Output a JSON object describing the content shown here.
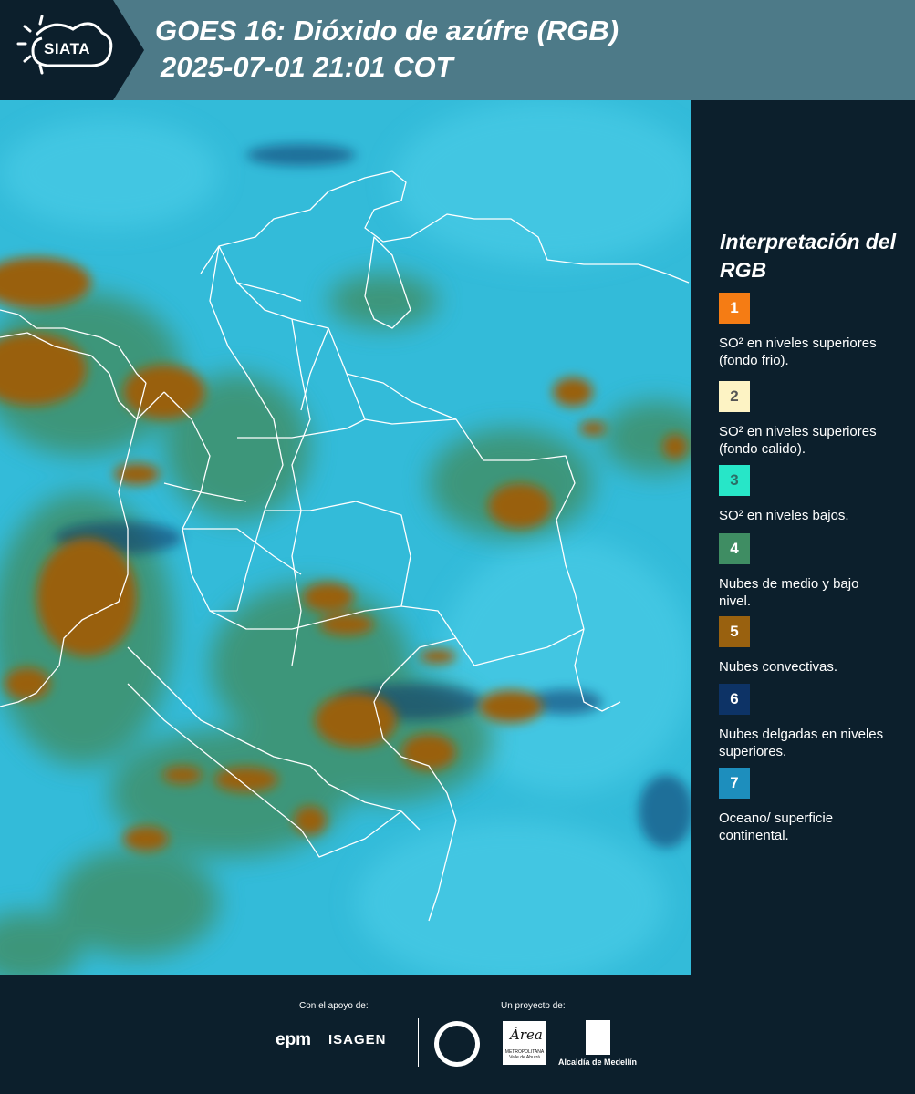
{
  "header": {
    "logo_text": "SIATA",
    "title_line1": "GOES 16: Dióxido de azúfre (RGB)",
    "title_line2": "2025-07-01 21:01 COT",
    "colors": {
      "bar": "#4d7a88",
      "logo_bg": "#0c1f2c"
    }
  },
  "legend": {
    "title": "Interpretación del RGB",
    "items": [
      {
        "num": "1",
        "color": "#f57c14",
        "text": "SO² en niveles superiores (fondo frio)."
      },
      {
        "num": "2",
        "color": "#fdf3c4",
        "text": "SO² en niveles superiores (fondo calido)."
      },
      {
        "num": "3",
        "color": "#27e6c8",
        "text": "SO² en niveles bajos."
      },
      {
        "num": "4",
        "color": "#3f8d63",
        "text": "Nubes de medio y bajo nivel."
      },
      {
        "num": "5",
        "color": "#99610f",
        "text": "Nubes convectivas."
      },
      {
        "num": "6",
        "color": "#0d3366",
        "text": "Nubes delgadas en niveles superiores."
      },
      {
        "num": "7",
        "color": "#1d8ebd",
        "text": "Oceano/ superficie continental."
      }
    ]
  },
  "footer": {
    "support_label": "Con el apoyo de:",
    "project_label": "Un proyecto de:",
    "sponsor1": "epm",
    "sponsor2": "ISAGEN",
    "area_logo_word": "Área",
    "area_logo_sub": "METROPOLITANA Valle de Aburrá",
    "alcaldia": "Alcaldía de Medellín"
  },
  "map": {
    "colors": {
      "surface": "#2fb7d6",
      "low_cloud": "#3f8d63",
      "convective": "#99610f",
      "border": "#ffffff"
    }
  }
}
